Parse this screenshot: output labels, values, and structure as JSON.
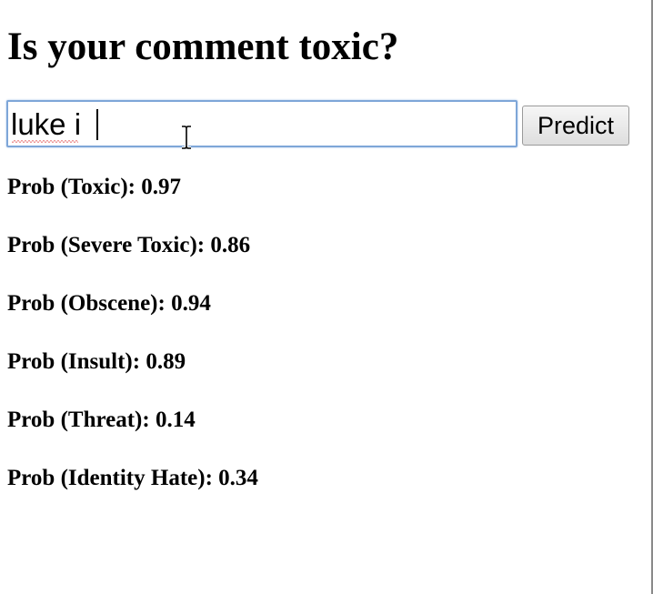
{
  "page": {
    "title": "Is your comment toxic?"
  },
  "form": {
    "input_value": "luke i",
    "predict_label": "Predict"
  },
  "results": [
    {
      "label": "Prob (Toxic): ",
      "value": "0.97"
    },
    {
      "label": "Prob (Severe Toxic): ",
      "value": "0.86"
    },
    {
      "label": "Prob (Obscene): ",
      "value": "0.94"
    },
    {
      "label": "Prob (Insult): ",
      "value": "0.89"
    },
    {
      "label": "Prob (Threat): ",
      "value": "0.14"
    },
    {
      "label": "Prob (Identity Hate): ",
      "value": "0.34"
    }
  ],
  "icons": {
    "cursor": "text-cursor-icon"
  },
  "colors": {
    "input_focus_border": "#7ea6d8",
    "spellcheck_underline": "#dd3333",
    "button_border": "#9a9a9a"
  }
}
